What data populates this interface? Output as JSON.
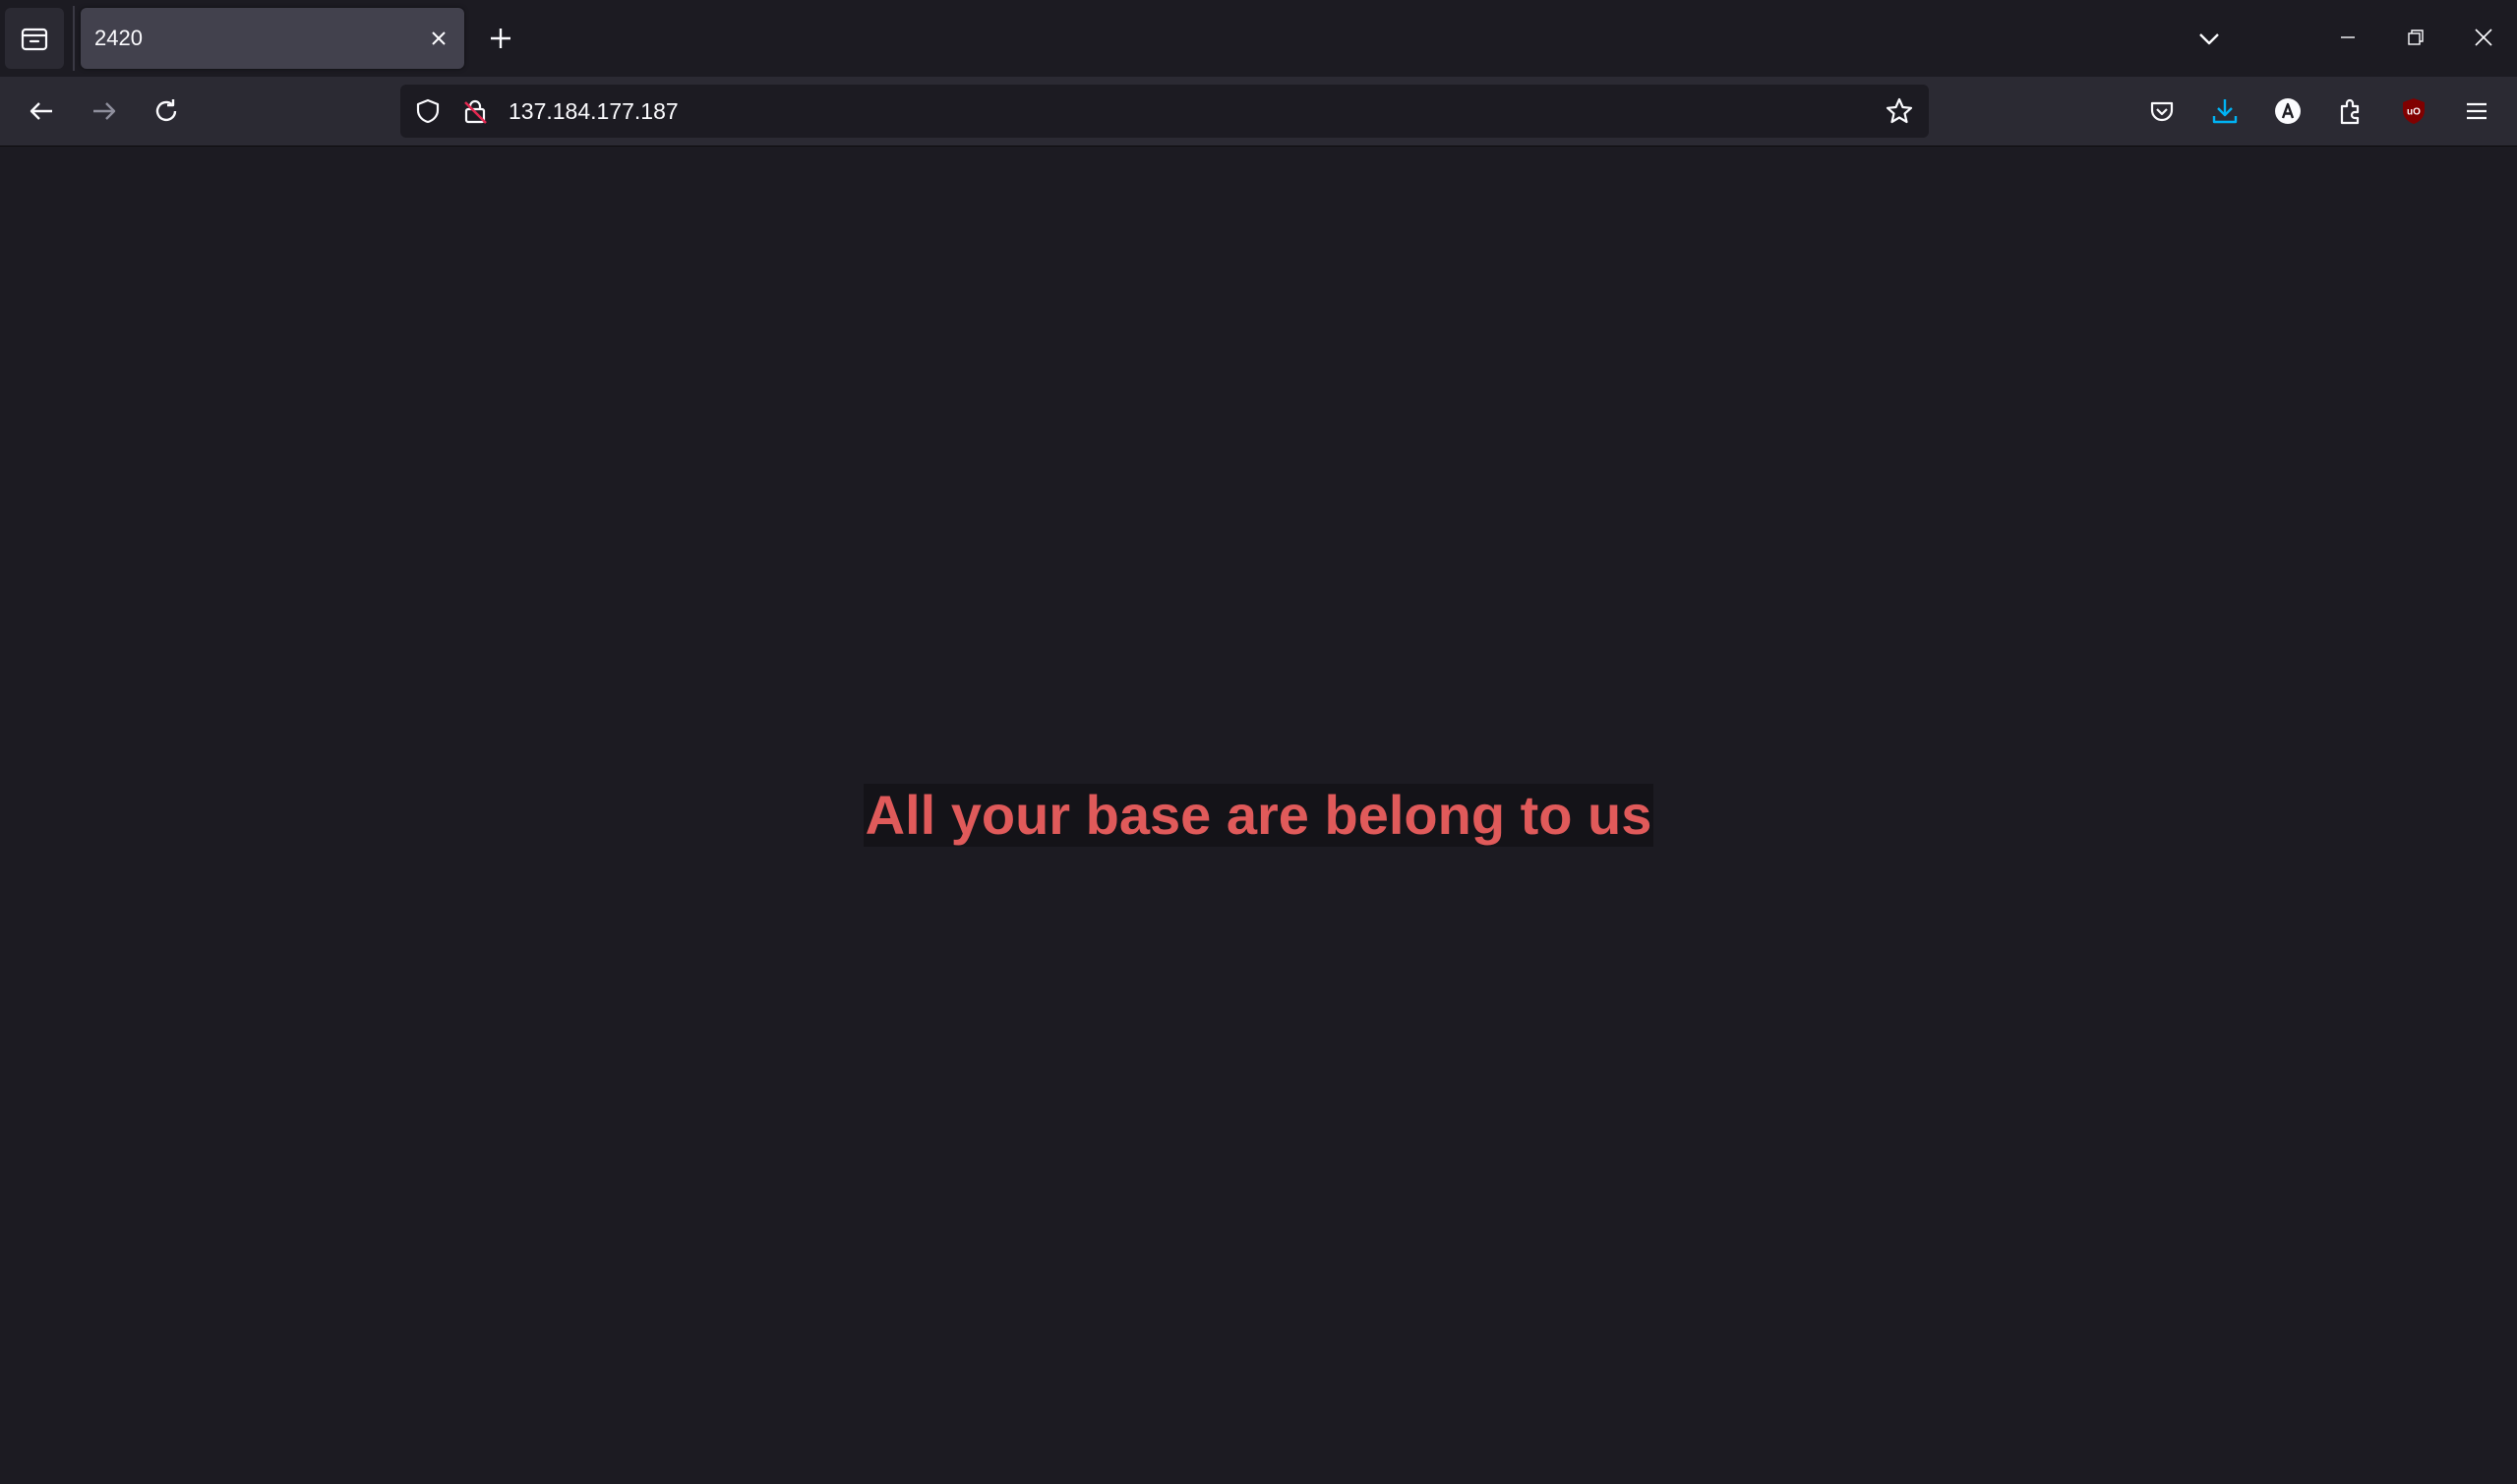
{
  "browser": {
    "tab": {
      "title": "2420"
    },
    "urlbar": {
      "url": "137.184.177.187"
    },
    "colors": {
      "toolbar": "#2b2a33",
      "tabstrip": "#1c1b22",
      "active_tab": "#42414d",
      "download_accent": "#00b3f4",
      "ublock": "#800000"
    },
    "icons": {
      "firefox_view": "firefox-view-icon",
      "tab_close": "close-icon",
      "new_tab": "plus-icon",
      "tab_list": "chevron-down-icon",
      "back": "arrow-left-icon",
      "forward": "arrow-right-icon",
      "reload": "reload-icon",
      "tracking_protection": "shield-icon",
      "connection": "lock-insecure-icon",
      "bookmark": "star-icon",
      "pocket": "pocket-icon",
      "downloads": "download-icon",
      "account": "account-icon",
      "extensions": "puzzle-icon",
      "ublock": "ublock-origin-icon",
      "menu": "hamburger-menu-icon"
    }
  },
  "page": {
    "headline": "All your base are belong to us",
    "headline_color": "#e05a5a",
    "background": "#1c1b22"
  }
}
